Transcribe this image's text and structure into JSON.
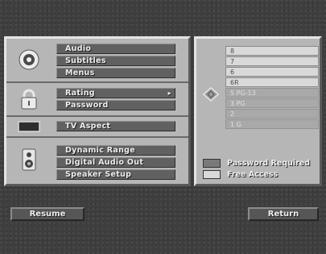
{
  "menu_groups": {
    "audio_group": {
      "icon": "disc-icon",
      "items": [
        "Audio",
        "Subtitles",
        "Menus"
      ]
    },
    "lock_group": {
      "icon": "padlock-icon",
      "items": [
        "Rating",
        "Password"
      ],
      "submenu_indicator": "▸"
    },
    "aspect_group": {
      "icon": "tv-screen-icon",
      "items": [
        "TV Aspect"
      ]
    },
    "speaker_group": {
      "icon": "speaker-icon",
      "items": [
        "Dynamic Range",
        "Digital Audio Out",
        "Speaker Setup"
      ]
    }
  },
  "rating_panel": {
    "options": [
      "8",
      "7",
      "6",
      "6R",
      "5 PG-13",
      "3 PG",
      "2",
      "1 G"
    ],
    "dimmed_from_index": 4
  },
  "legend": {
    "password_required": {
      "label": "Password Required",
      "color": "#7a7a7a"
    },
    "free_access": {
      "label": "Free Access",
      "color": "#d9d9d9"
    }
  },
  "buttons": {
    "resume": "Resume",
    "return": "Return"
  }
}
